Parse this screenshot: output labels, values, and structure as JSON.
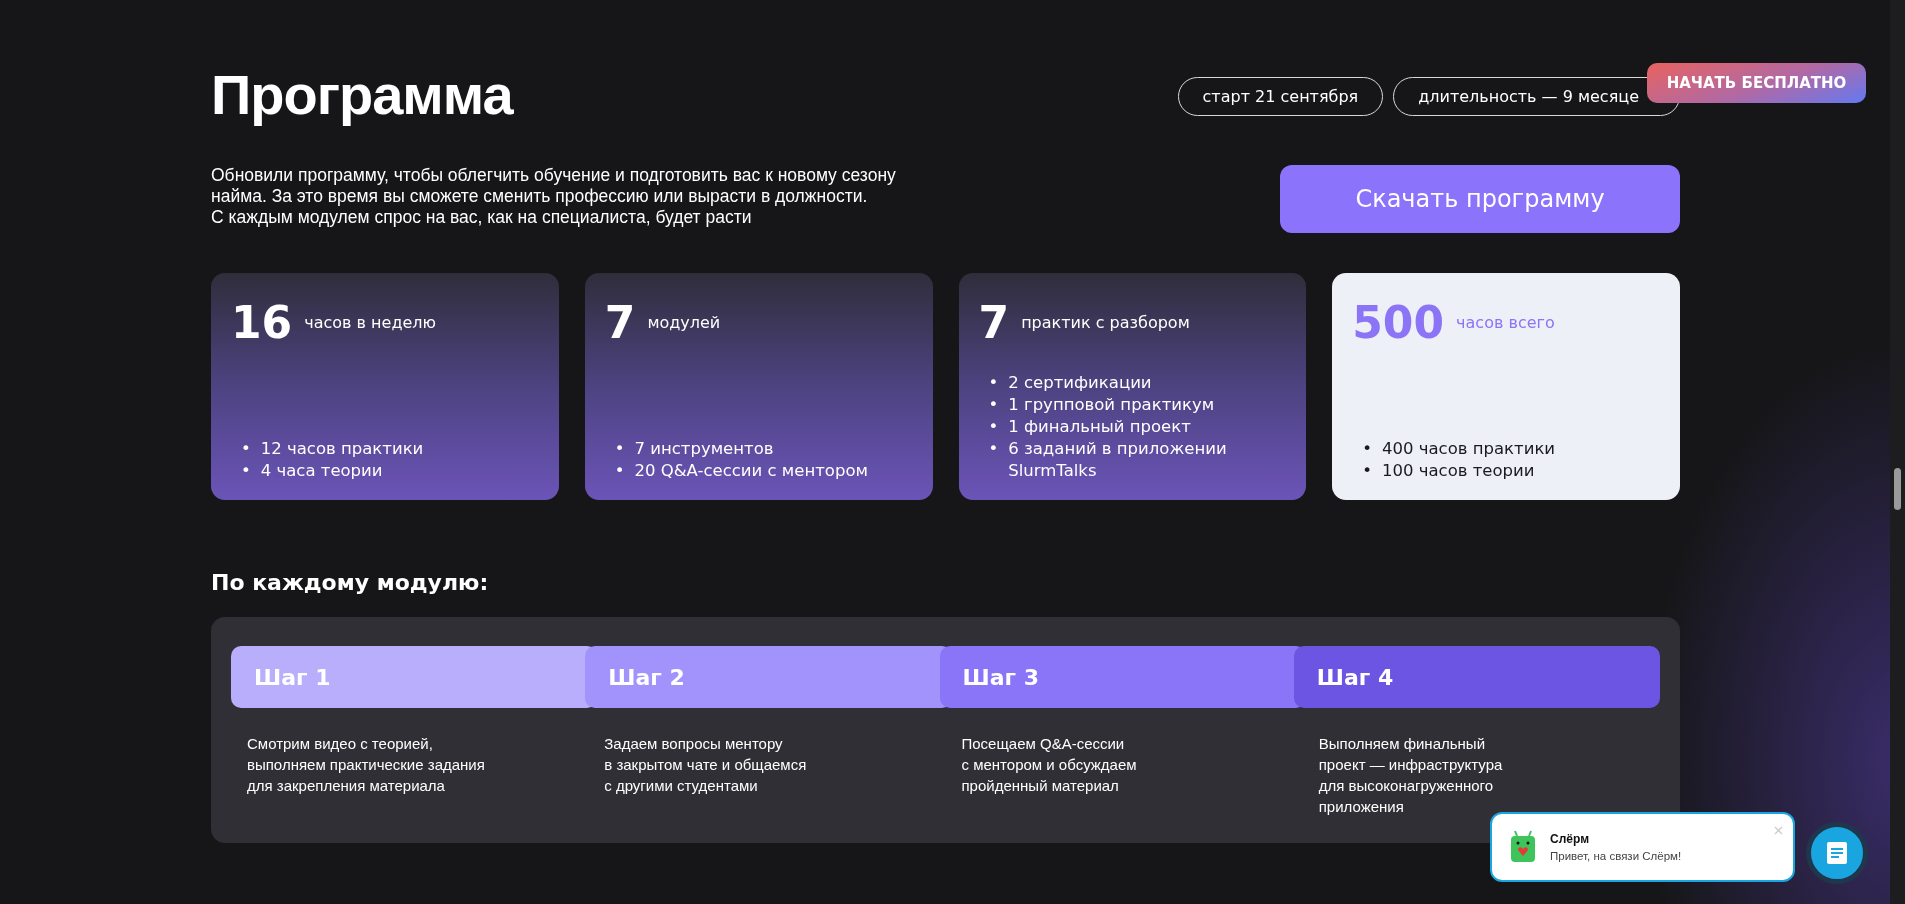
{
  "header": {
    "title": "Программа",
    "chips": [
      "старт 21 сентября",
      "длительность — 9 месяце"
    ]
  },
  "start_button": {
    "label": "НАЧАТЬ БЕСПЛАТНО"
  },
  "intro": {
    "lines": [
      "Обновили программу, чтобы облегчить обучение и подготовить вас к новому сезону",
      "найма. За это время вы сможете сменить профессию или вырасти в должности.",
      "С каждым модулем спрос на вас, как на специалиста, будет расти"
    ],
    "download_button": "Скачать программу"
  },
  "stats": [
    {
      "kind": "dark",
      "number": "16",
      "bullet": "•",
      "caption": "часов в неделю",
      "items": [
        "12 часов практики",
        "4 часа теории"
      ]
    },
    {
      "kind": "dark",
      "number": "7",
      "bullet": "•",
      "caption": "модулей",
      "items": [
        "7 инструментов",
        "20 Q&A-сессии с ментором"
      ]
    },
    {
      "kind": "dark",
      "number": "7",
      "bullet": "•",
      "caption": "практик с разбором",
      "items": [
        "2 сертификации",
        "1 групповой практикум",
        "1 финальный проект",
        "6 заданий в приложении SlurmTalks"
      ]
    },
    {
      "kind": "light",
      "number": "500",
      "bullet": "•",
      "caption": "часов всего",
      "items": [
        "400 часов практики",
        "100 часов теории"
      ]
    }
  ],
  "modules": {
    "heading": "По каждому модулю:",
    "steps": [
      {
        "title": "Шаг 1",
        "color": "#b8aefc",
        "lines": [
          "Смотрим видео с теорией,",
          "выполняем практические задания",
          "для закрепления материала"
        ]
      },
      {
        "title": "Шаг 2",
        "color": "#a193fb",
        "lines": [
          "Задаем вопросы ментору",
          "в закрытом чате и общаемся",
          "с другими студентами"
        ]
      },
      {
        "title": "Шаг 3",
        "color": "#8a74f8",
        "lines": [
          "Посещаем Q&A-сессии",
          "с ментором и обсуждаем",
          "пройденный материал"
        ]
      },
      {
        "title": "Шаг 4",
        "color": "#6c55e2",
        "lines": [
          "Выполняем финальный",
          "проект — инфраструктура",
          "для высоконагруженного",
          "приложения"
        ]
      }
    ]
  },
  "chat": {
    "name": "Слёрм",
    "message": "Привет, на связи Слёрм!"
  }
}
